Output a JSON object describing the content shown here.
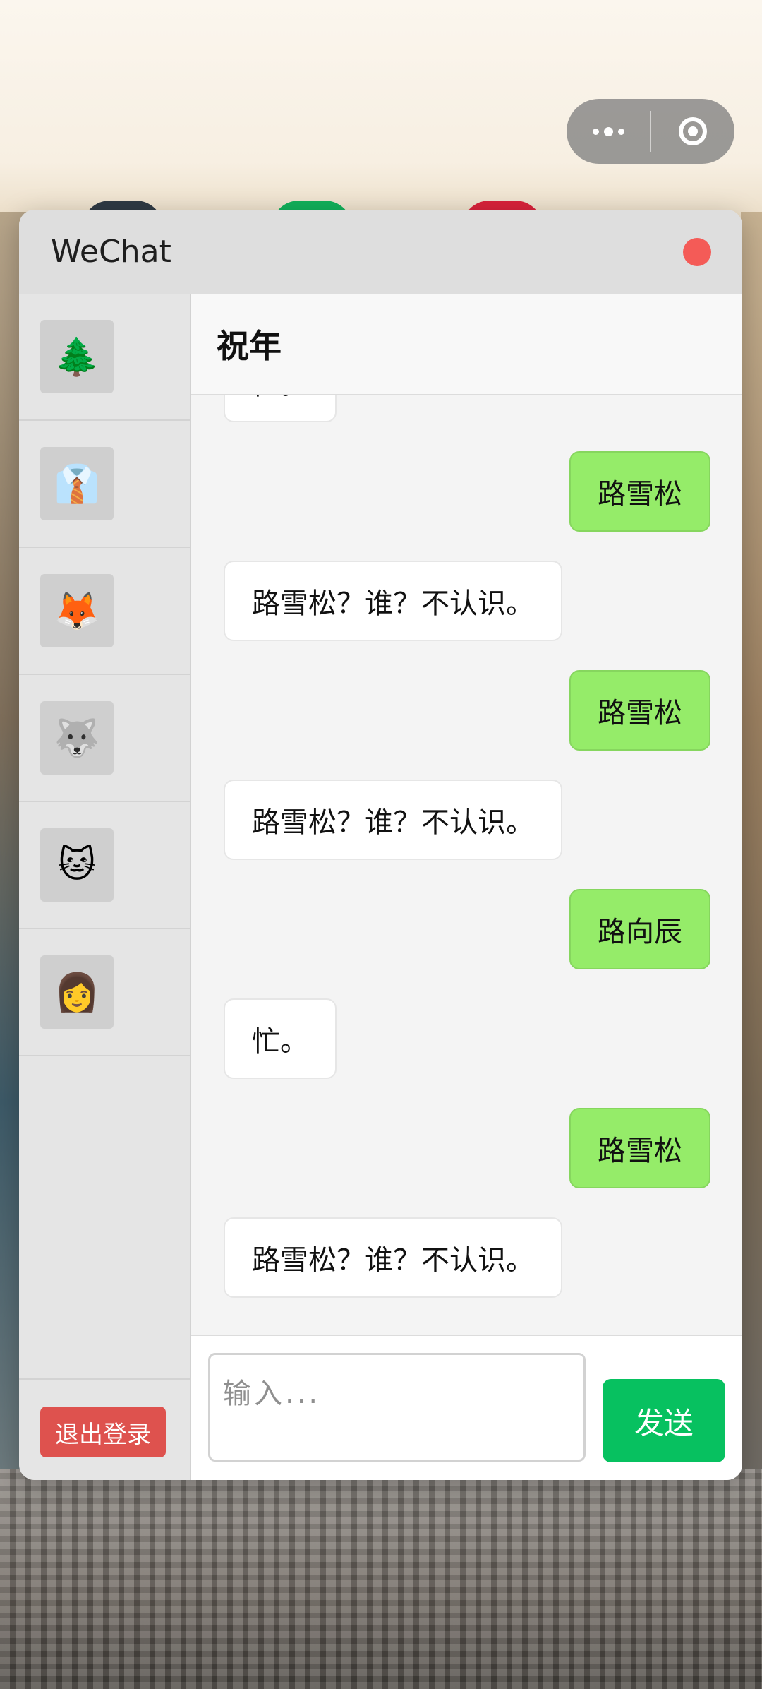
{
  "window": {
    "title": "WeChat"
  },
  "contacts": [
    {
      "avatar": "🌲",
      "icon": "tree-avatar-icon"
    },
    {
      "avatar": "👔",
      "icon": "necktie-avatar-icon"
    },
    {
      "avatar": "🦊",
      "icon": "fox-avatar-icon"
    },
    {
      "avatar": "🐺",
      "icon": "wolf-avatar-icon"
    },
    {
      "avatar": "🐱",
      "icon": "cat-avatar-icon"
    },
    {
      "avatar": "👩",
      "icon": "woman-avatar-icon"
    }
  ],
  "sidebar": {
    "logout_label": "退出登录"
  },
  "chat": {
    "name": "祝年",
    "messages": [
      {
        "from": "them",
        "text": "忙。"
      },
      {
        "from": "me",
        "text": "路雪松"
      },
      {
        "from": "them",
        "text": "路雪松？谁？不认识。"
      },
      {
        "from": "me",
        "text": "路雪松"
      },
      {
        "from": "them",
        "text": "路雪松？谁？不认识。"
      },
      {
        "from": "me",
        "text": "路向辰"
      },
      {
        "from": "them",
        "text": "忙。"
      },
      {
        "from": "me",
        "text": "路雪松"
      },
      {
        "from": "them",
        "text": "路雪松？谁？不认识。"
      }
    ]
  },
  "composer": {
    "placeholder": "输入...",
    "send_label": "发送"
  },
  "colors": {
    "accent": "#07c160",
    "outgoing_bubble": "#95ec69",
    "logout": "#de524e",
    "close": "#f45b57"
  }
}
